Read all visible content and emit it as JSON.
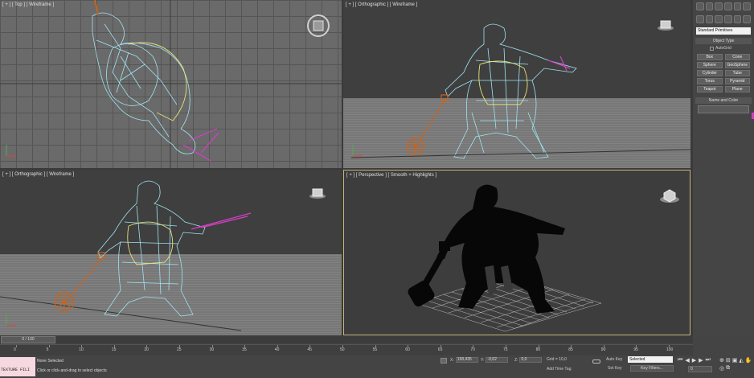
{
  "viewports": {
    "top_left": {
      "label": "[ + ] [ Top ] [ Wireframe ]"
    },
    "top_right": {
      "label": "[ + ] [ Orthographic ] [ Wireframe ]"
    },
    "bottom_left": {
      "label": "[ + ] [ Orthographic ] [ Wireframe ]"
    },
    "bottom_right": {
      "label": "[ + ] [ Perspective ] [ Smooth + Highlights ]"
    }
  },
  "command_panel": {
    "primitive_type": "Standard Primitives",
    "object_type_title": "Object Type",
    "autogrid_label": "AutoGrid",
    "buttons": [
      "Box",
      "Cone",
      "Sphere",
      "GeoSphere",
      "Cylinder",
      "Tube",
      "Torus",
      "Pyramid",
      "Teapot",
      "Plane"
    ],
    "name_color_title": "Name and Color"
  },
  "timeline": {
    "frame_counter": "0 / 100",
    "ticks": [
      "0",
      "5",
      "10",
      "15",
      "20",
      "25",
      "30",
      "35",
      "40",
      "45",
      "50",
      "55",
      "60",
      "65",
      "70",
      "75",
      "80",
      "85",
      "90",
      "95",
      "100"
    ]
  },
  "status_bar": {
    "maxscript_text": "TEXTURE FILI",
    "selection_status": "None Selected",
    "prompt": "Click or click-and-drag to select objects",
    "x_label": "X:",
    "x_value": "158,435",
    "y_label": "Y:",
    "y_value": "-0,62",
    "z_label": "Z:",
    "z_value": "0,0",
    "grid": "Grid = 10,0",
    "add_time_tag": "Add Time Tag",
    "auto_key": "Auto Key",
    "selected_option": "Selected",
    "set_key": "Set Key",
    "key_filters": "Key Filters...",
    "current_frame": "0"
  },
  "colors": {
    "viewport_active_border": "#c8b47a",
    "wire_cyan": "#9fe4f0",
    "wire_yellow": "#e8e27a",
    "weapon_orange": "#c8641e",
    "sword_magenta": "#d040c0",
    "maxscript_bg": "#f6d8e0"
  }
}
